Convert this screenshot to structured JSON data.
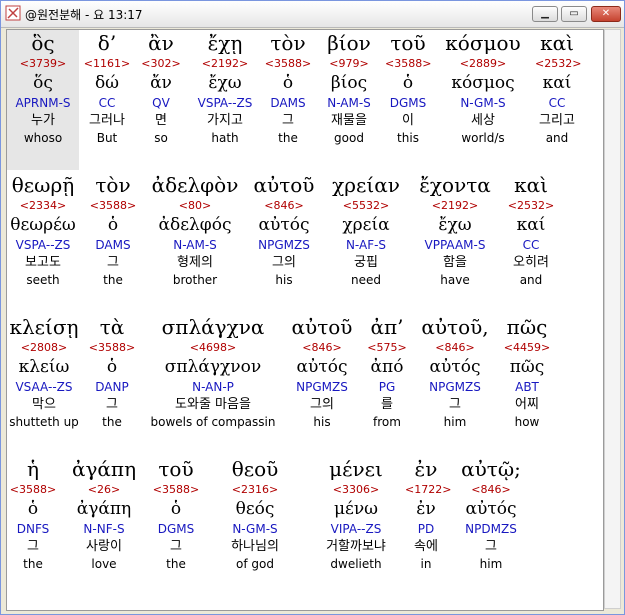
{
  "window": {
    "title": "@원전분해 - 요 13:17",
    "minimize_icon": "minimize-icon",
    "maximize_icon": "maximize-icon",
    "close_icon": "close-icon"
  },
  "rows": [
    [
      {
        "greek": "ὃς",
        "strong": "<3739>",
        "lemma": "ὅς",
        "parse": "APRNM-S",
        "korean": "누가",
        "english": "whoso"
      },
      {
        "greek": "δ’",
        "strong": "<1161>",
        "lemma": "δώ",
        "parse": "CC",
        "korean": "그러나",
        "english": "But"
      },
      {
        "greek": "ἂν",
        "strong": "<302>",
        "lemma": "ἄν",
        "parse": "QV",
        "korean": "면",
        "english": "so"
      },
      {
        "greek": "ἔχῃ",
        "strong": "<2192>",
        "lemma": "ἔχω",
        "parse": "VSPA--ZS",
        "korean": "가지고",
        "english": "hath"
      },
      {
        "greek": "τὸν",
        "strong": "<3588>",
        "lemma": "ὁ",
        "parse": "DAMS",
        "korean": "그",
        "english": "the"
      },
      {
        "greek": "βίον",
        "strong": "<979>",
        "lemma": "βίος",
        "parse": "N-AM-S",
        "korean": "재물을",
        "english": "good"
      },
      {
        "greek": "τοῦ",
        "strong": "<3588>",
        "lemma": "ὁ",
        "parse": "DGMS",
        "korean": "이",
        "english": "this"
      },
      {
        "greek": "κόσμου",
        "strong": "<2889>",
        "lemma": "κόσμος",
        "parse": "N-GM-S",
        "korean": "세상",
        "english": "world/s"
      },
      {
        "greek": "καὶ",
        "strong": "<2532>",
        "lemma": "καί",
        "parse": "CC",
        "korean": "그리고",
        "english": "and"
      }
    ],
    [
      {
        "greek": "θεωρῇ",
        "strong": "<2334>",
        "lemma": "θεωρέω",
        "parse": "VSPA--ZS",
        "korean": "보고도",
        "english": "seeth"
      },
      {
        "greek": "τὸν",
        "strong": "<3588>",
        "lemma": "ὁ",
        "parse": "DAMS",
        "korean": "그",
        "english": "the"
      },
      {
        "greek": "ἀδελφὸν",
        "strong": "<80>",
        "lemma": "ἀδελφός",
        "parse": "N-AM-S",
        "korean": "형제의",
        "english": "brother"
      },
      {
        "greek": "αὐτοῦ",
        "strong": "<846>",
        "lemma": "αὐτός",
        "parse": "NPGMZS",
        "korean": "그의",
        "english": "his"
      },
      {
        "greek": "χρείαν",
        "strong": "<5532>",
        "lemma": "χρεία",
        "parse": "N-AF-S",
        "korean": "궁핍",
        "english": "need"
      },
      {
        "greek": "ἔχοντα",
        "strong": "<2192>",
        "lemma": "ἔχω",
        "parse": "VPPAAM-S",
        "korean": "함을",
        "english": "have"
      },
      {
        "greek": "καὶ",
        "strong": "<2532>",
        "lemma": "καί",
        "parse": "CC",
        "korean": "오히려",
        "english": "and"
      }
    ],
    [
      {
        "greek": "κλείσῃ",
        "strong": "<2808>",
        "lemma": "κλείω",
        "parse": "VSAA--ZS",
        "korean": "막으",
        "english": "shutteth up"
      },
      {
        "greek": "τὰ",
        "strong": "<3588>",
        "lemma": "ὁ",
        "parse": "DANP",
        "korean": "그",
        "english": "the"
      },
      {
        "greek": "σπλάγχνα",
        "strong": "<4698>",
        "lemma": "σπλάγχνον",
        "parse": "N-AN-P",
        "korean": "도와줄 마음을",
        "english": "bowels of compassin"
      },
      {
        "greek": "αὐτοῦ",
        "strong": "<846>",
        "lemma": "αὐτός",
        "parse": "NPGMZS",
        "korean": "그의",
        "english": "his"
      },
      {
        "greek": "ἀπ’",
        "strong": "<575>",
        "lemma": "ἀπό",
        "parse": "PG",
        "korean": "를",
        "english": "from"
      },
      {
        "greek": "αὐτοῦ,",
        "strong": "<846>",
        "lemma": "αὐτός",
        "parse": "NPGMZS",
        "korean": "그",
        "english": "him"
      },
      {
        "greek": "πῶς",
        "strong": "<4459>",
        "lemma": "πῶς",
        "parse": "ABT",
        "korean": "어찌",
        "english": "how"
      }
    ],
    [
      {
        "greek": "ἡ",
        "strong": "<3588>",
        "lemma": "ὁ",
        "parse": "DNFS",
        "korean": "그",
        "english": "the"
      },
      {
        "greek": "ἀγάπη",
        "strong": "<26>",
        "lemma": "ἀγάπη",
        "parse": "N-NF-S",
        "korean": "사랑이",
        "english": "love"
      },
      {
        "greek": "τοῦ",
        "strong": "<3588>",
        "lemma": "ὁ",
        "parse": "DGMS",
        "korean": "그",
        "english": "the"
      },
      {
        "greek": "θεοῦ",
        "strong": "<2316>",
        "lemma": "θεός",
        "parse": "N-GM-S",
        "korean": "하나님의",
        "english": "of god"
      },
      {
        "greek": "μένει",
        "strong": "<3306>",
        "lemma": "μένω",
        "parse": "VIPA--ZS",
        "korean": "거할까보냐",
        "english": "dwelieth"
      },
      {
        "greek": "ἐν",
        "strong": "<1722>",
        "lemma": "ἐν",
        "parse": "PD",
        "korean": "속에",
        "english": "in"
      },
      {
        "greek": "αὐτῷ;",
        "strong": "<846>",
        "lemma": "αὐτός",
        "parse": "NPDMZS",
        "korean": "그",
        "english": "him"
      }
    ]
  ]
}
